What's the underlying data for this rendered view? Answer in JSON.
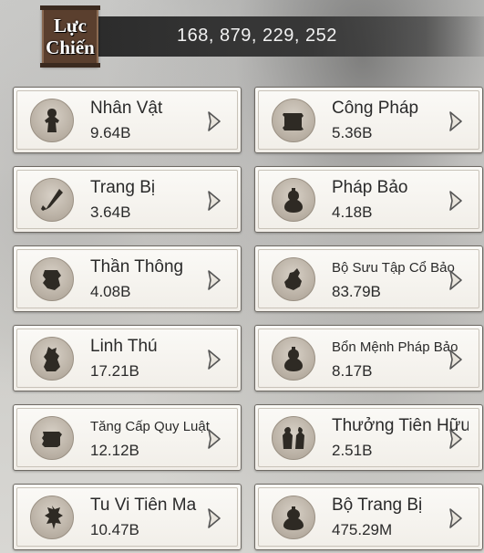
{
  "combat_power": {
    "label": "Lực\nChiến",
    "value": "168, 879, 229, 252"
  },
  "cards": [
    {
      "title": "Nhân Vật",
      "value": "9.64B",
      "icon": "character-icon"
    },
    {
      "title": "Công Pháp",
      "value": "5.36B",
      "icon": "scroll-icon"
    },
    {
      "title": "Trang Bị",
      "value": "3.64B",
      "icon": "equipment-icon"
    },
    {
      "title": "Pháp Bảo",
      "value": "4.18B",
      "icon": "treasure-gourd-icon"
    },
    {
      "title": "Thần Thông",
      "value": "4.08B",
      "icon": "divine-power-icon"
    },
    {
      "title": "Bộ Sưu Tập Cổ Bảo",
      "value": "83.79B",
      "icon": "collection-icon"
    },
    {
      "title": "Linh Thú",
      "value": "17.21B",
      "icon": "spirit-beast-icon"
    },
    {
      "title": "Bổn Mệnh Pháp Bảo",
      "value": "8.17B",
      "icon": "gourd-icon"
    },
    {
      "title": "Tăng Cấp Quy Luật",
      "value": "12.12B",
      "icon": "rule-upgrade-icon"
    },
    {
      "title": "Thưởng Tiên Hữu",
      "value": "2.51B",
      "icon": "companions-icon"
    },
    {
      "title": "Tu Vi Tiên Ma",
      "value": "10.47B",
      "icon": "immortal-demon-icon"
    },
    {
      "title": "Bộ Trang Bị",
      "value": "475.29M",
      "icon": "equipment-set-icon"
    }
  ],
  "colors": {
    "header_strip": "#2d2d2d",
    "tag_brown": "#5a3f2e",
    "card_bg": "#f5f2ec",
    "icon_dark": "#2e2a24"
  }
}
